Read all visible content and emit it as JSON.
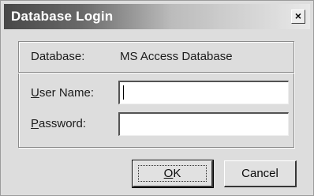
{
  "window": {
    "title": "Database Login",
    "close_glyph": "×"
  },
  "database": {
    "label": "Database:",
    "value": "MS Access Database"
  },
  "user_name": {
    "label_mnemonic": "U",
    "label_rest": "ser Name:",
    "value": ""
  },
  "password": {
    "label_mnemonic": "P",
    "label_rest": "assword:",
    "value": ""
  },
  "buttons": {
    "ok_mnemonic": "O",
    "ok_rest": "K",
    "cancel": "Cancel"
  }
}
